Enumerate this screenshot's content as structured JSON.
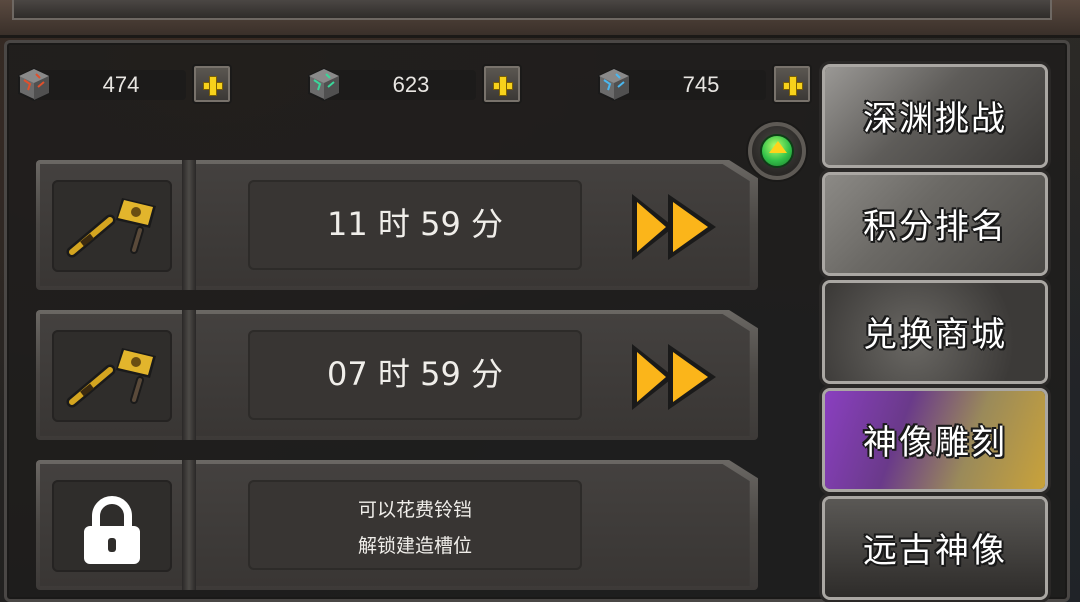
{
  "currencies": [
    {
      "icon": "red-cube-icon",
      "value": "474",
      "color": "#c94a2e"
    },
    {
      "icon": "green-cube-icon",
      "value": "623",
      "color": "#3ac48a"
    },
    {
      "icon": "blue-cube-icon",
      "value": "745",
      "color": "#3aa8e0"
    }
  ],
  "slots": [
    {
      "icon": "hammer-icon",
      "time": "11 时 59 分"
    },
    {
      "icon": "hammer-icon",
      "time": "07 时 59 分"
    },
    {
      "icon": "lock-icon",
      "lock_line1": "可以花费铃铛",
      "lock_line2": "解锁建造槽位"
    }
  ],
  "menu": [
    {
      "label": "深渊挑战"
    },
    {
      "label": "积分排名"
    },
    {
      "label": "兑换商城"
    },
    {
      "label": "神像雕刻",
      "active": true
    },
    {
      "label": "远古神像"
    }
  ],
  "colors": {
    "accent_yellow": "#f7c21b",
    "active_purple": "#8a3fc0",
    "active_gold": "#c9a23a"
  }
}
